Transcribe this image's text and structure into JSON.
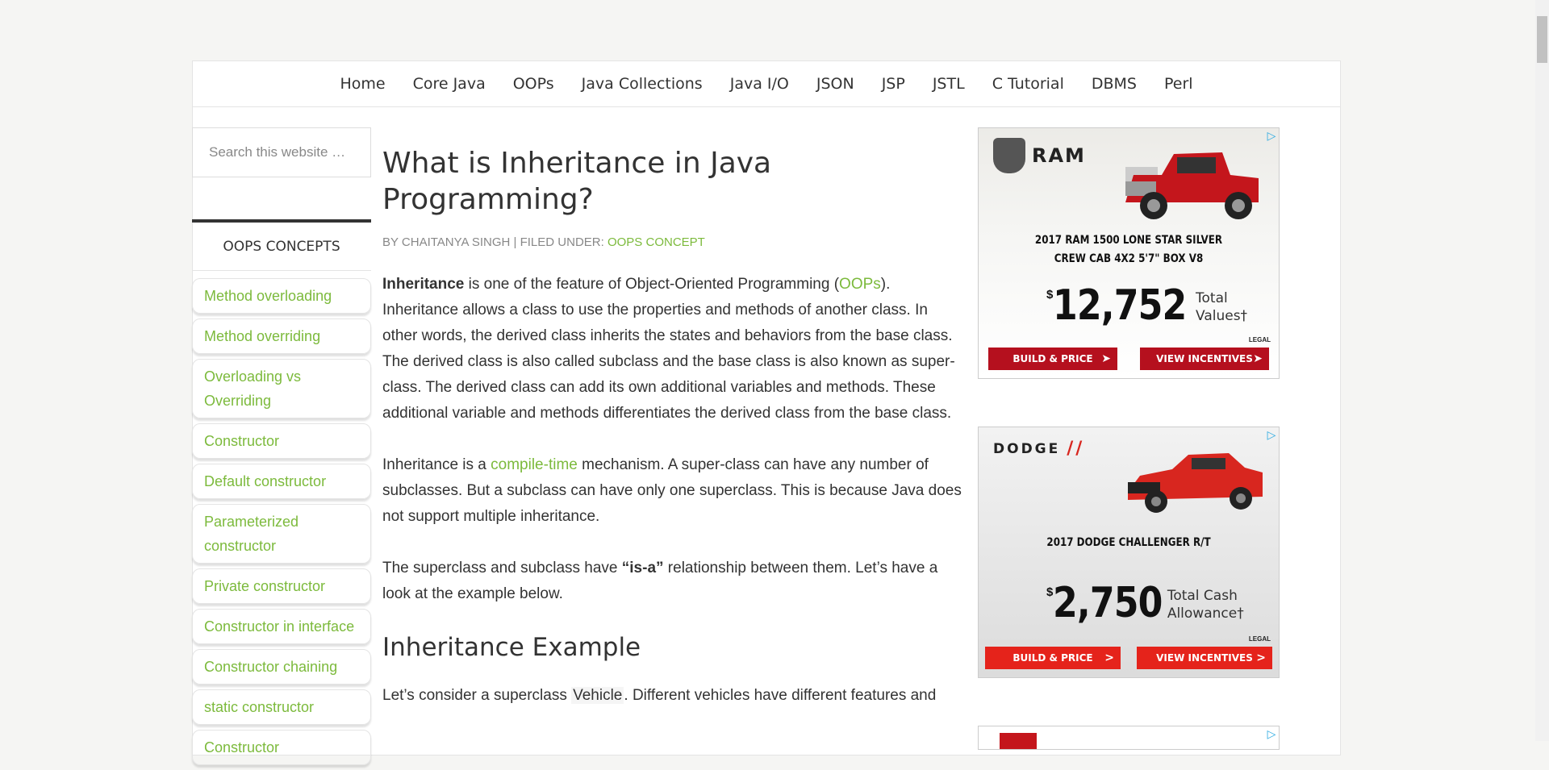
{
  "nav": {
    "items": [
      "Home",
      "Core Java",
      "OOPs",
      "Java Collections",
      "Java I/O",
      "JSON",
      "JSP",
      "JSTL",
      "C Tutorial",
      "DBMS",
      "Perl"
    ]
  },
  "sidebar": {
    "search_placeholder": "Search this website …",
    "widget_title": "OOPS CONCEPTS",
    "items": [
      "Method overloading",
      "Method overriding",
      "Overloading vs Overriding",
      "Constructor",
      "Default constructor",
      "Parameterized constructor",
      "Private constructor",
      "Constructor in interface",
      "Constructor chaining",
      "static constructor",
      "Constructor"
    ]
  },
  "article": {
    "title": "What is Inheritance in Java Programming?",
    "meta_by": "BY CHAITANYA SINGH | FILED UNDER:",
    "meta_category": "OOPS CONCEPT",
    "p1_bold": "Inheritance",
    "p1_a": " is one of the feature of Object-Oriented Programming (",
    "p1_link": "OOPs",
    "p1_b": "). Inheritance allows a class to use the properties and methods of another class. In other words, the derived class inherits the states and behaviors from the base class. The derived class is also called subclass and the base class is also known as super-class. The derived class can add its own additional variables and methods. These additional variable and methods differentiates the derived class from the base class.",
    "p2_a": "Inheritance is a ",
    "p2_link": "compile-time",
    "p2_b": " mechanism. A super-class can have any number of subclasses. But a subclass can have only one superclass. This is because Java does not support multiple inheritance.",
    "p3_a": "The superclass and subclass have ",
    "p3_bold": "“is-a”",
    "p3_b": " relationship between them. Let’s have a look at the example below.",
    "h2": "Inheritance Example",
    "p4_a": "Let’s consider a superclass ",
    "p4_code": "Vehicle",
    "p4_b": ". Different vehicles have different features and"
  },
  "ads": {
    "ram": {
      "brand": "RAM",
      "title_line1": "2017 RAM 1500 LONE STAR SILVER",
      "title_line2": "CREW CAB 4X2 5'7\" BOX V8",
      "currency": "$",
      "price": "12,752",
      "price_caption_1": "Total",
      "price_caption_2": "Values†",
      "legal": "LEGAL",
      "cta1": "BUILD & PRICE",
      "cta2": "VIEW INCENTIVES",
      "car_color": "#c4161c"
    },
    "dodge": {
      "brand": "DODGE",
      "title": "2017 DODGE CHALLENGER R/T",
      "currency": "$",
      "price": "2,750",
      "price_caption_1": "Total Cash",
      "price_caption_2": "Allowance†",
      "legal": "LEGAL",
      "cta1": "BUILD & PRICE",
      "cta2": "VIEW INCENTIVES",
      "car_color": "#d8261f"
    },
    "adchoices_icon": "adchoices-icon"
  },
  "colors": {
    "link": "#7cba3c",
    "text": "#333333",
    "background": "#f5f5f3"
  }
}
